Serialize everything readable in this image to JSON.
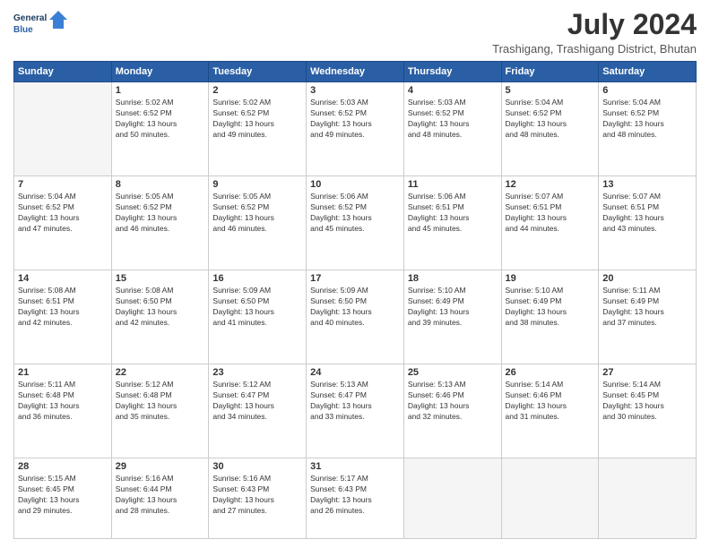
{
  "header": {
    "logo_line1": "General",
    "logo_line2": "Blue",
    "month_year": "July 2024",
    "location": "Trashigang, Trashigang District, Bhutan"
  },
  "days_of_week": [
    "Sunday",
    "Monday",
    "Tuesday",
    "Wednesday",
    "Thursday",
    "Friday",
    "Saturday"
  ],
  "weeks": [
    [
      {
        "day": "",
        "info": ""
      },
      {
        "day": "1",
        "info": "Sunrise: 5:02 AM\nSunset: 6:52 PM\nDaylight: 13 hours\nand 50 minutes."
      },
      {
        "day": "2",
        "info": "Sunrise: 5:02 AM\nSunset: 6:52 PM\nDaylight: 13 hours\nand 49 minutes."
      },
      {
        "day": "3",
        "info": "Sunrise: 5:03 AM\nSunset: 6:52 PM\nDaylight: 13 hours\nand 49 minutes."
      },
      {
        "day": "4",
        "info": "Sunrise: 5:03 AM\nSunset: 6:52 PM\nDaylight: 13 hours\nand 48 minutes."
      },
      {
        "day": "5",
        "info": "Sunrise: 5:04 AM\nSunset: 6:52 PM\nDaylight: 13 hours\nand 48 minutes."
      },
      {
        "day": "6",
        "info": "Sunrise: 5:04 AM\nSunset: 6:52 PM\nDaylight: 13 hours\nand 48 minutes."
      }
    ],
    [
      {
        "day": "7",
        "info": "Sunrise: 5:04 AM\nSunset: 6:52 PM\nDaylight: 13 hours\nand 47 minutes."
      },
      {
        "day": "8",
        "info": "Sunrise: 5:05 AM\nSunset: 6:52 PM\nDaylight: 13 hours\nand 46 minutes."
      },
      {
        "day": "9",
        "info": "Sunrise: 5:05 AM\nSunset: 6:52 PM\nDaylight: 13 hours\nand 46 minutes."
      },
      {
        "day": "10",
        "info": "Sunrise: 5:06 AM\nSunset: 6:52 PM\nDaylight: 13 hours\nand 45 minutes."
      },
      {
        "day": "11",
        "info": "Sunrise: 5:06 AM\nSunset: 6:51 PM\nDaylight: 13 hours\nand 45 minutes."
      },
      {
        "day": "12",
        "info": "Sunrise: 5:07 AM\nSunset: 6:51 PM\nDaylight: 13 hours\nand 44 minutes."
      },
      {
        "day": "13",
        "info": "Sunrise: 5:07 AM\nSunset: 6:51 PM\nDaylight: 13 hours\nand 43 minutes."
      }
    ],
    [
      {
        "day": "14",
        "info": "Sunrise: 5:08 AM\nSunset: 6:51 PM\nDaylight: 13 hours\nand 42 minutes."
      },
      {
        "day": "15",
        "info": "Sunrise: 5:08 AM\nSunset: 6:50 PM\nDaylight: 13 hours\nand 42 minutes."
      },
      {
        "day": "16",
        "info": "Sunrise: 5:09 AM\nSunset: 6:50 PM\nDaylight: 13 hours\nand 41 minutes."
      },
      {
        "day": "17",
        "info": "Sunrise: 5:09 AM\nSunset: 6:50 PM\nDaylight: 13 hours\nand 40 minutes."
      },
      {
        "day": "18",
        "info": "Sunrise: 5:10 AM\nSunset: 6:49 PM\nDaylight: 13 hours\nand 39 minutes."
      },
      {
        "day": "19",
        "info": "Sunrise: 5:10 AM\nSunset: 6:49 PM\nDaylight: 13 hours\nand 38 minutes."
      },
      {
        "day": "20",
        "info": "Sunrise: 5:11 AM\nSunset: 6:49 PM\nDaylight: 13 hours\nand 37 minutes."
      }
    ],
    [
      {
        "day": "21",
        "info": "Sunrise: 5:11 AM\nSunset: 6:48 PM\nDaylight: 13 hours\nand 36 minutes."
      },
      {
        "day": "22",
        "info": "Sunrise: 5:12 AM\nSunset: 6:48 PM\nDaylight: 13 hours\nand 35 minutes."
      },
      {
        "day": "23",
        "info": "Sunrise: 5:12 AM\nSunset: 6:47 PM\nDaylight: 13 hours\nand 34 minutes."
      },
      {
        "day": "24",
        "info": "Sunrise: 5:13 AM\nSunset: 6:47 PM\nDaylight: 13 hours\nand 33 minutes."
      },
      {
        "day": "25",
        "info": "Sunrise: 5:13 AM\nSunset: 6:46 PM\nDaylight: 13 hours\nand 32 minutes."
      },
      {
        "day": "26",
        "info": "Sunrise: 5:14 AM\nSunset: 6:46 PM\nDaylight: 13 hours\nand 31 minutes."
      },
      {
        "day": "27",
        "info": "Sunrise: 5:14 AM\nSunset: 6:45 PM\nDaylight: 13 hours\nand 30 minutes."
      }
    ],
    [
      {
        "day": "28",
        "info": "Sunrise: 5:15 AM\nSunset: 6:45 PM\nDaylight: 13 hours\nand 29 minutes."
      },
      {
        "day": "29",
        "info": "Sunrise: 5:16 AM\nSunset: 6:44 PM\nDaylight: 13 hours\nand 28 minutes."
      },
      {
        "day": "30",
        "info": "Sunrise: 5:16 AM\nSunset: 6:43 PM\nDaylight: 13 hours\nand 27 minutes."
      },
      {
        "day": "31",
        "info": "Sunrise: 5:17 AM\nSunset: 6:43 PM\nDaylight: 13 hours\nand 26 minutes."
      },
      {
        "day": "",
        "info": ""
      },
      {
        "day": "",
        "info": ""
      },
      {
        "day": "",
        "info": ""
      }
    ]
  ]
}
